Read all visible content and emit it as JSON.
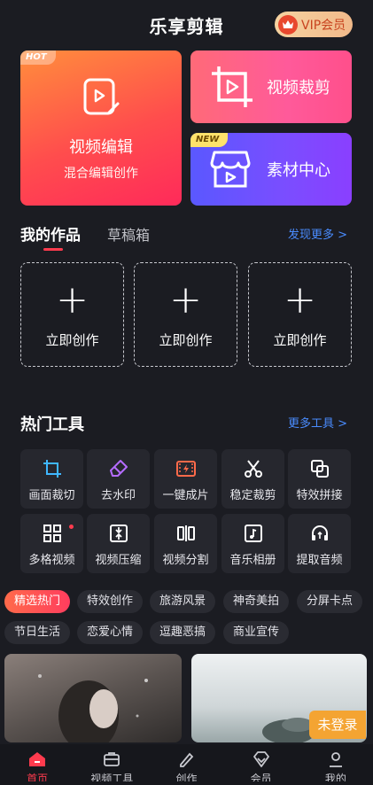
{
  "header": {
    "title": "乐享剪辑",
    "vip_label": "VIP会员"
  },
  "cards": {
    "edit": {
      "tag": "HOT",
      "title": "视频编辑",
      "subtitle": "混合编辑创作"
    },
    "crop": {
      "title": "视频裁剪"
    },
    "materials": {
      "tag": "NEW",
      "title": "素材中心"
    }
  },
  "works": {
    "tabs": [
      "我的作品",
      "草稿箱"
    ],
    "more_label": "发现更多 >",
    "slots": [
      "立即创作",
      "立即创作",
      "立即创作"
    ]
  },
  "tools": {
    "title": "热门工具",
    "more_label": "更多工具 >",
    "items": [
      {
        "label": "画面裁切",
        "icon": "crop-icon"
      },
      {
        "label": "去水印",
        "icon": "eraser-icon"
      },
      {
        "label": "一键成片",
        "icon": "film-spark-icon"
      },
      {
        "label": "稳定裁剪",
        "icon": "scissors-icon"
      },
      {
        "label": "特效拼接",
        "icon": "layers-icon"
      },
      {
        "label": "多格视频",
        "icon": "grid-icon"
      },
      {
        "label": "视频压缩",
        "icon": "compress-icon"
      },
      {
        "label": "视频分割",
        "icon": "split-icon"
      },
      {
        "label": "音乐相册",
        "icon": "music-album-icon"
      },
      {
        "label": "提取音频",
        "icon": "audio-extract-icon"
      }
    ]
  },
  "chips": {
    "row1": [
      "精选热门",
      "特效创作",
      "旅游风景",
      "神奇美拍",
      "分屏卡点"
    ],
    "row2": [
      "节日生活",
      "恋爱心情",
      "逗趣恶搞",
      "商业宣传"
    ]
  },
  "login_badge": "未登录",
  "nav": [
    "首页",
    "视频工具",
    "创作",
    "会员",
    "我的"
  ],
  "colors": {
    "accent": "#ff3b4e",
    "link": "#4a8cff",
    "vip_gold": "#f1b98a",
    "bg": "#1b1c22"
  }
}
